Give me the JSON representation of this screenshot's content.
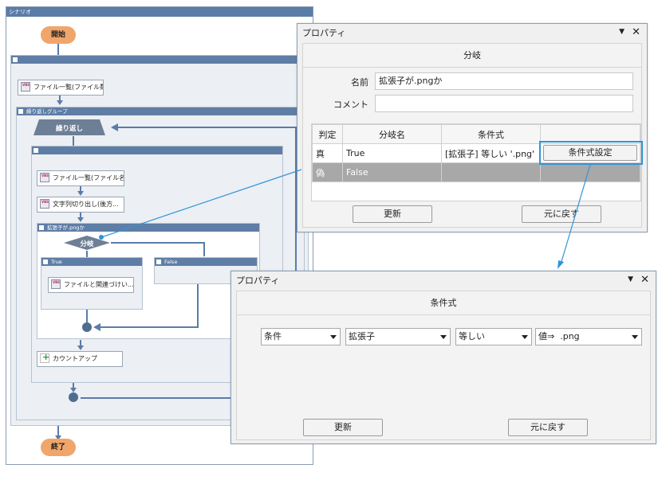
{
  "scenario": {
    "title": "シナリオ",
    "start": "開始",
    "end": "終了",
    "loop_group_label": "繰り返しグループ",
    "loop_label": "繰り返し",
    "actions": {
      "file_list_count": "ファイル一覧(ファイル数...",
      "file_list_name": "ファイル一覧(ファイル名...",
      "substring": "文字列切り出し(後方...",
      "file_assoc": "ファイルと関連づけい...",
      "count_up": "カウントアップ"
    },
    "branch_group_label": "拡張子が.pngか",
    "branch_label": "分岐",
    "true_label": "True",
    "false_label": "False"
  },
  "prop1": {
    "title": "プロパティ",
    "panel_title": "分岐",
    "name_label": "名前",
    "name_value": "拡張子が.pngか",
    "comment_label": "コメント",
    "comment_value": "",
    "columns": [
      "判定",
      "分岐名",
      "条件式",
      ""
    ],
    "rows": [
      {
        "judge": "真",
        "name": "True",
        "cond": "[拡張子] 等しい '.png'"
      },
      {
        "judge": "偽",
        "name": "False",
        "cond": ""
      }
    ],
    "cond_button": "条件式設定",
    "update": "更新",
    "revert": "元に戻す"
  },
  "prop2": {
    "title": "プロパティ",
    "panel_title": "条件式",
    "dd1": "条件",
    "dd2": "拡張子",
    "dd3": "等しい",
    "dd4_prefix": "値⇒",
    "dd4_value": ".png",
    "update": "更新",
    "revert": "元に戻す"
  },
  "colors": {
    "accent": "#2f95d8",
    "group_header": "#5f7ea6",
    "pill": "#f0a66b"
  }
}
